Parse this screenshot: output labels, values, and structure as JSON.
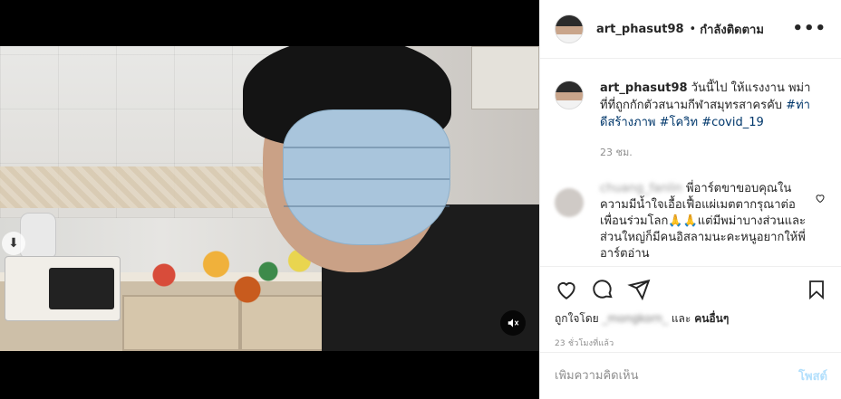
{
  "header": {
    "username": "art_phasut98",
    "separator": "•",
    "follow_status": "กำลังติดตาม",
    "more_icon": "more-horizontal-icon"
  },
  "caption": {
    "username": "art_phasut98",
    "text": "วันนี้ไป ให้แรงงาน พม่าที่ที่ถูกกักตัวสนามกีฬาสมุทรสาครคับ",
    "hashtags": [
      "#ท่าดีสร้างภาพ",
      "#โควิท",
      "#covid_19"
    ],
    "time": "23 ชม."
  },
  "comment": {
    "username": "chuang_fanlin",
    "text": "พี่อาร์ตขาขอบคุณในความมีน้ำใจเอื้อเฟื้อแผ่เมตตากรุณาต่อเพื่อนร่วมโลก🙏🙏แต่มีพม่าบางส่วนและส่วนใหญ่ก็มีคนอิสลามนะคะหนูอยากให้พี่อาร์ตอ่าน"
  },
  "actions": {
    "icons": [
      "heart-icon",
      "comment-icon",
      "share-icon",
      "bookmark-icon"
    ]
  },
  "likes": {
    "prefix": "ถูกใจโดย",
    "liker": "_mongkorn_",
    "conjunction": "และ",
    "others": "คนอื่นๆ"
  },
  "post_time": "23 ชั่วโมงที่แล้ว",
  "add_comment": {
    "placeholder": "เพิ่มความคิดเห็น",
    "post_label": "โพสต์"
  },
  "media": {
    "mute_icon": "volume-muted-icon",
    "prev_icon": "arrow-down-icon"
  },
  "colors": {
    "hashtag": "#00376b",
    "post_button_disabled": "#b2dffc",
    "meta_text": "#8e8e8e"
  }
}
